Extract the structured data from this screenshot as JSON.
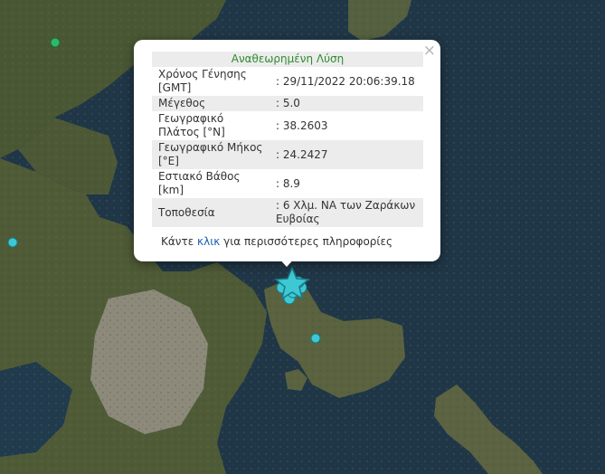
{
  "popup": {
    "title": "Αναθεωρημένη Λύση",
    "close_symbol": "×",
    "rows": [
      {
        "label": "Χρόνος Γένησης [GMT]",
        "value": ": 29/11/2022 20:06:39.18"
      },
      {
        "label": "Μέγεθος",
        "value": ": 5.0"
      },
      {
        "label": "Γεωγραφικό Πλάτος [°N]",
        "value": ": 38.2603"
      },
      {
        "label": "Γεωγραφικό Μήκος [°E]",
        "value": ": 24.2427"
      },
      {
        "label": "Εστιακό Βάθος [km]",
        "value": ": 8.9"
      },
      {
        "label": "Τοποθεσία",
        "value": ": 6 Χλμ. ΝΑ των Ζαράκων Ευβοίας"
      }
    ],
    "more_prefix": "Κάντε ",
    "more_link": "κλικ",
    "more_suffix": " για περισσότερες πληροφορίες"
  },
  "markers": {
    "main_event_icon": "star-icon",
    "other_event_icon": "circle-icon",
    "colors": {
      "recent": "#3ec8d4",
      "older": "#2fb86a"
    }
  },
  "colors": {
    "sea": "#1d3547",
    "land": "#4d5a36",
    "title": "#2e8b2e",
    "link": "#1a5fb4"
  }
}
